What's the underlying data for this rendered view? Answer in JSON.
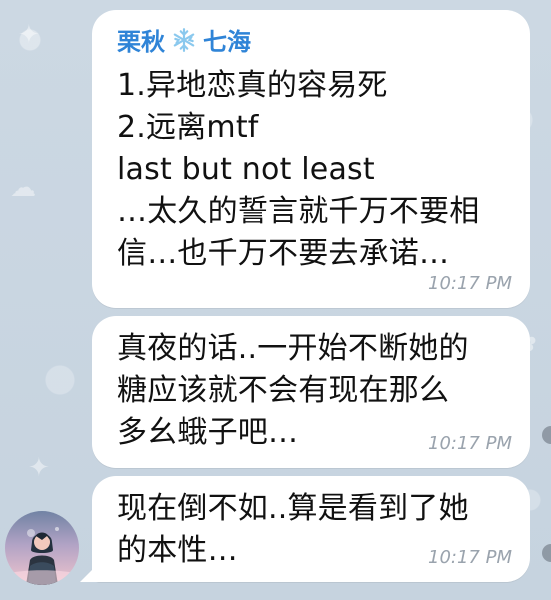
{
  "chat": {
    "sender_name": "栗秋",
    "sender_alias": "七海",
    "messages": [
      {
        "text": "1.异地恋真的容易死\n2.远离mtf\nlast but not least\n…太久的誓言就千万不要相\n信…也千万不要去承诺…",
        "time": "10:17 PM"
      },
      {
        "text": "真夜的话..一开始不断她的\n糖应该就不会有现在那么\n多幺蛾子吧…",
        "time": "10:17 PM"
      },
      {
        "text": "现在倒不如..算是看到了她\n的本性…",
        "time": "10:17 PM"
      }
    ]
  },
  "colors": {
    "background": "#c9d6e2",
    "bubble": "#ffffff",
    "sender": "#2f84d7",
    "text": "#111111",
    "timestamp": "#9aa3ad"
  },
  "icons": {
    "sender_decoration": "snowflake-icon",
    "avatar": "profile-avatar"
  }
}
